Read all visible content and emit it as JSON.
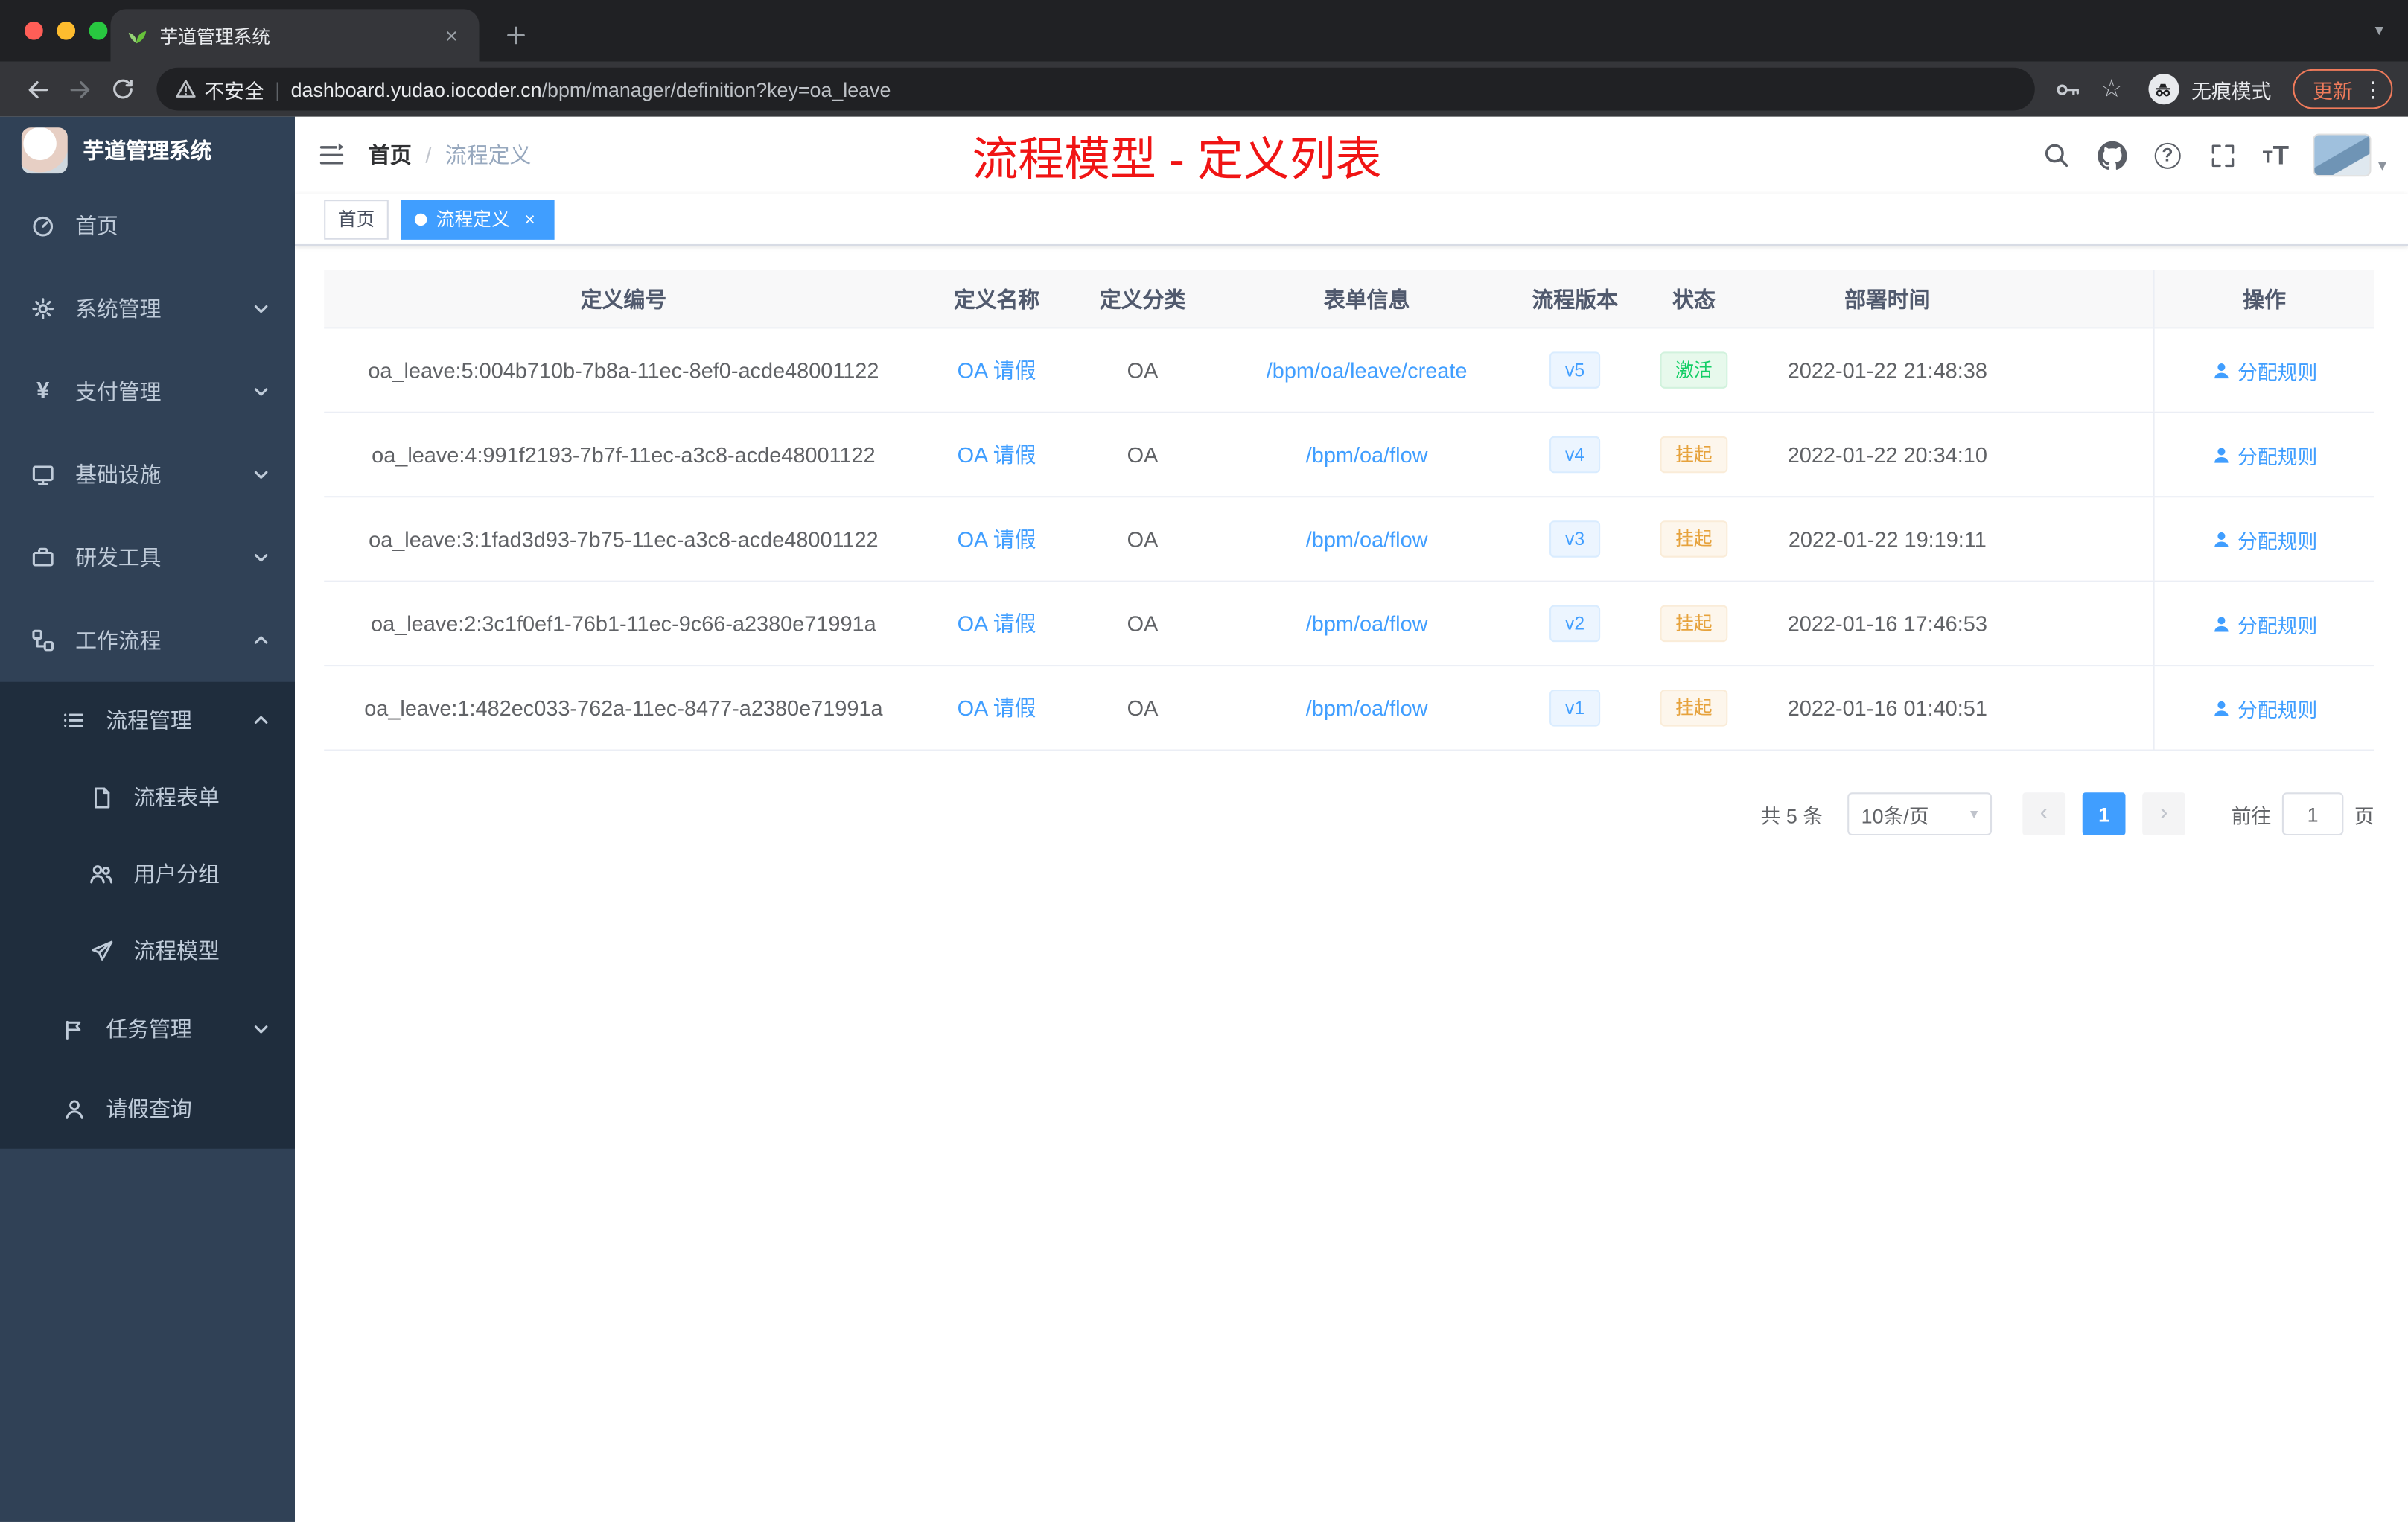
{
  "icons": {
    "star": "☆",
    "question": "?",
    "caret_down": "▾",
    "dots_vertical": "⋮",
    "yen": "¥",
    "tab_close": "×",
    "tag_close": "×",
    "divider": "|",
    "prev": "‹",
    "next": "›",
    "tab_chevron": "▾",
    "font_glyph": "T"
  },
  "browser": {
    "tab_title": "芋道管理系统",
    "security_label": "不安全",
    "url_domain": "dashboard.yudao.iocoder.cn",
    "url_path": "/bpm/manager/definition?key=oa_leave",
    "incognito_label": "无痕模式",
    "update_label": "更新"
  },
  "sidebar": {
    "title": "芋道管理系统",
    "menu": [
      {
        "label": "首页"
      },
      {
        "label": "系统管理"
      },
      {
        "label": "支付管理"
      },
      {
        "label": "基础设施"
      },
      {
        "label": "研发工具"
      },
      {
        "label": "工作流程"
      }
    ],
    "submenu": [
      {
        "label": "流程管理"
      },
      {
        "label": "流程表单"
      },
      {
        "label": "用户分组"
      },
      {
        "label": "流程模型"
      },
      {
        "label": "任务管理"
      },
      {
        "label": "请假查询"
      }
    ]
  },
  "header": {
    "breadcrumb_home": "首页",
    "breadcrumb_separator": "/",
    "breadcrumb_current": "流程定义",
    "annotation": "流程模型 - 定义列表"
  },
  "tags": [
    {
      "label": "首页"
    },
    {
      "label": "流程定义"
    }
  ],
  "table": {
    "headers": [
      "定义编号",
      "定义名称",
      "定义分类",
      "表单信息",
      "流程版本",
      "状态",
      "部署时间",
      "操作"
    ],
    "rows": [
      {
        "id": "oa_leave:5:004b710b-7b8a-11ec-8ef0-acde48001122",
        "name": "OA 请假",
        "category": "OA",
        "form": "/bpm/oa/leave/create",
        "version": "v5",
        "status": "激活",
        "time": "2022-01-22 21:48:38",
        "action": "分配规则"
      },
      {
        "id": "oa_leave:4:991f2193-7b7f-11ec-a3c8-acde48001122",
        "name": "OA 请假",
        "category": "OA",
        "form": "/bpm/oa/flow",
        "version": "v4",
        "status": "挂起",
        "time": "2022-01-22 20:34:10",
        "action": "分配规则"
      },
      {
        "id": "oa_leave:3:1fad3d93-7b75-11ec-a3c8-acde48001122",
        "name": "OA 请假",
        "category": "OA",
        "form": "/bpm/oa/flow",
        "version": "v3",
        "status": "挂起",
        "time": "2022-01-22 19:19:11",
        "action": "分配规则"
      },
      {
        "id": "oa_leave:2:3c1f0ef1-76b1-11ec-9c66-a2380e71991a",
        "name": "OA 请假",
        "category": "OA",
        "form": "/bpm/oa/flow",
        "version": "v2",
        "status": "挂起",
        "time": "2022-01-16 17:46:53",
        "action": "分配规则"
      },
      {
        "id": "oa_leave:1:482ec033-762a-11ec-8477-a2380e71991a",
        "name": "OA 请假",
        "category": "OA",
        "form": "/bpm/oa/flow",
        "version": "v1",
        "status": "挂起",
        "time": "2022-01-16 01:40:51",
        "action": "分配规则"
      }
    ]
  },
  "pagination": {
    "total": "共 5 条",
    "page_size": "10条/页",
    "current_page": "1",
    "goto_label": "前往",
    "goto_value": "1",
    "page_unit": "页"
  },
  "colors": {
    "accent_blue": "#409eff",
    "sidebar_bg": "#304156",
    "submenu_bg": "#1f2d3d",
    "annotation_red": "#f01414",
    "status_active_green": "#13ce66",
    "status_suspended_orange": "#e6a23c"
  }
}
